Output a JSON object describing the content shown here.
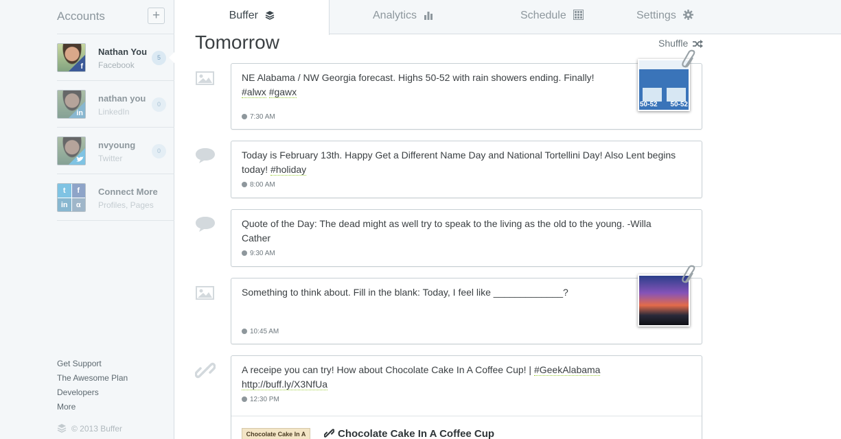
{
  "sidebar": {
    "title": "Accounts",
    "add_label": "+",
    "profiles": [
      {
        "name": "Nathan You",
        "network": "Facebook",
        "count": "5",
        "icon": "facebook-icon"
      },
      {
        "name": "nathan you",
        "network": "LinkedIn",
        "count": "0",
        "icon": "linkedin-icon"
      },
      {
        "name": "nvyoung",
        "network": "Twitter",
        "count": "0",
        "icon": "twitter-icon"
      }
    ],
    "connect": {
      "name": "Connect More",
      "sub": "Profiles, Pages"
    },
    "links": [
      "Get Support",
      "The Awesome Plan",
      "Developers",
      "More"
    ],
    "copyright": "© 2013 Buffer"
  },
  "tabs": [
    {
      "label": "Buffer",
      "icon": "layers-icon"
    },
    {
      "label": "Analytics",
      "icon": "bar-chart-icon"
    },
    {
      "label": "Schedule",
      "icon": "calendar-icon"
    },
    {
      "label": "Settings",
      "icon": "gear-icon"
    }
  ],
  "main": {
    "day_title": "Tomorrow",
    "shuffle_label": "Shuffle"
  },
  "posts": [
    {
      "type": "image",
      "text_plain": "NE Alabama / NW Georgia forecast. Highs 50-52 with rain showers ending.  Finally! ",
      "tags": [
        "#alwx",
        "#gawx"
      ],
      "time": "7:30 AM",
      "thumb": {
        "lbl1": "50-52",
        "lbl2": "50-52"
      }
    },
    {
      "type": "status",
      "text_plain": "Today is February 13th.  Happy Get a Different Name Day and National Tortellini Day! Also Lent begins today! ",
      "tags": [
        "#holiday"
      ],
      "time": "8:00 AM"
    },
    {
      "type": "status",
      "text_plain": "Quote of the Day: The dead might as well try to speak to the living as the old to the young. -Willa Cather",
      "tags": [],
      "time": "9:30 AM"
    },
    {
      "type": "image",
      "text_plain": "Something to think about.  Fill in the blank: Today, I feel like _____________?",
      "tags": [],
      "time": "10:45 AM"
    },
    {
      "type": "link",
      "text_plain": "A receipe you can try!  How about Chocolate Cake In A Coffee Cup! | ",
      "tags": [
        "#GeekAlabama"
      ],
      "url": "http://buff.ly/X3NfUa",
      "time": "12:30 PM",
      "link_title": "Chocolate Cake In A Coffee Cup",
      "link_thumb": "Chocolate Cake In A Coffee Cup"
    }
  ],
  "colors": {
    "accent": "#3b5998",
    "sidebar_bg": "#f4f7f9",
    "hashtag_underline": "#9acd32"
  }
}
